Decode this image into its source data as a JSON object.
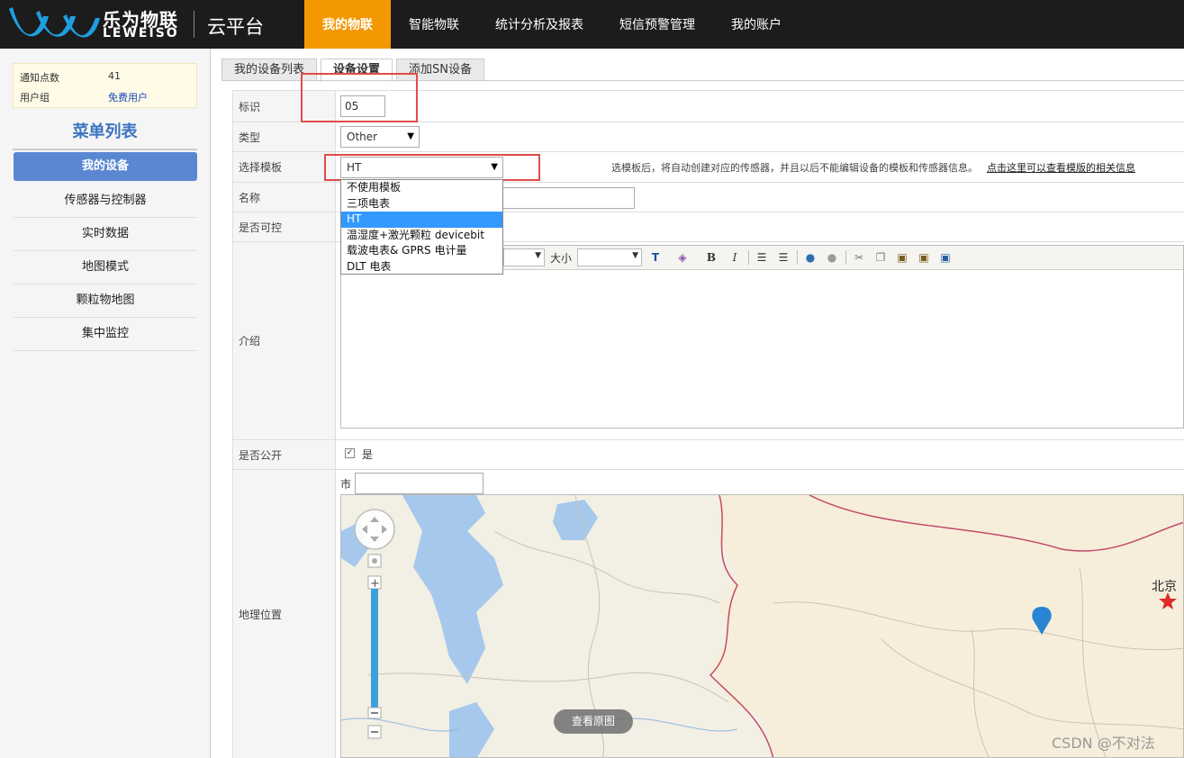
{
  "header": {
    "logo_cn": "乐为物联",
    "logo_en": "LEWEISO",
    "subtitle": "云平台",
    "nav": [
      {
        "label": "我的物联",
        "active": true
      },
      {
        "label": "智能物联"
      },
      {
        "label": "统计分析及报表"
      },
      {
        "label": "短信预警管理"
      },
      {
        "label": "我的账户"
      }
    ]
  },
  "sidebar": {
    "info": {
      "notify_label": "通知点数",
      "notify_value": "41",
      "group_label": "用户组",
      "group_value": "免费用户"
    },
    "menu_title": "菜单列表",
    "items": [
      {
        "label": "我的设备",
        "active": true
      },
      {
        "label": "传感器与控制器"
      },
      {
        "label": "实时数据"
      },
      {
        "label": "地图模式"
      },
      {
        "label": "颗粒物地图"
      },
      {
        "label": "集中监控"
      }
    ]
  },
  "tabs": [
    {
      "label": "我的设备列表"
    },
    {
      "label": "设备设置",
      "active": true
    },
    {
      "label": "添加SN设备"
    }
  ],
  "form": {
    "id_label": "标识",
    "id_value": "05",
    "type_label": "类型",
    "type_value": "Other",
    "template_label": "选择模板",
    "template_value": "HT",
    "template_hint": "选模板后，将自动创建对应的传感器，并且以后不能编辑设备的模板和传感器信息。",
    "template_link": "点击这里可以查看模版的相关信息",
    "template_options": [
      "不使用模板",
      "三项电表",
      "HT",
      "温湿度+激光颗粒 devicebit",
      "载波电表& GPRS 电计量",
      "DLT 电表"
    ],
    "name_label": "名称",
    "controllable_label": "是否可控",
    "intro_label": "介绍",
    "editor_size_label": "大小",
    "public_label": "是否公开",
    "public_value": "是",
    "location_label": "地理位置",
    "city_label": "市",
    "map_city": "北京",
    "map_button": "查看原图"
  },
  "watermark": "CSDN @不对法",
  "colors": {
    "header_bg": "#1c1c1c",
    "nav_active": "#f39800",
    "menu_active": "#5b87d2",
    "highlight_box": "#e04b4b",
    "dropdown_selected": "#3399ff"
  }
}
